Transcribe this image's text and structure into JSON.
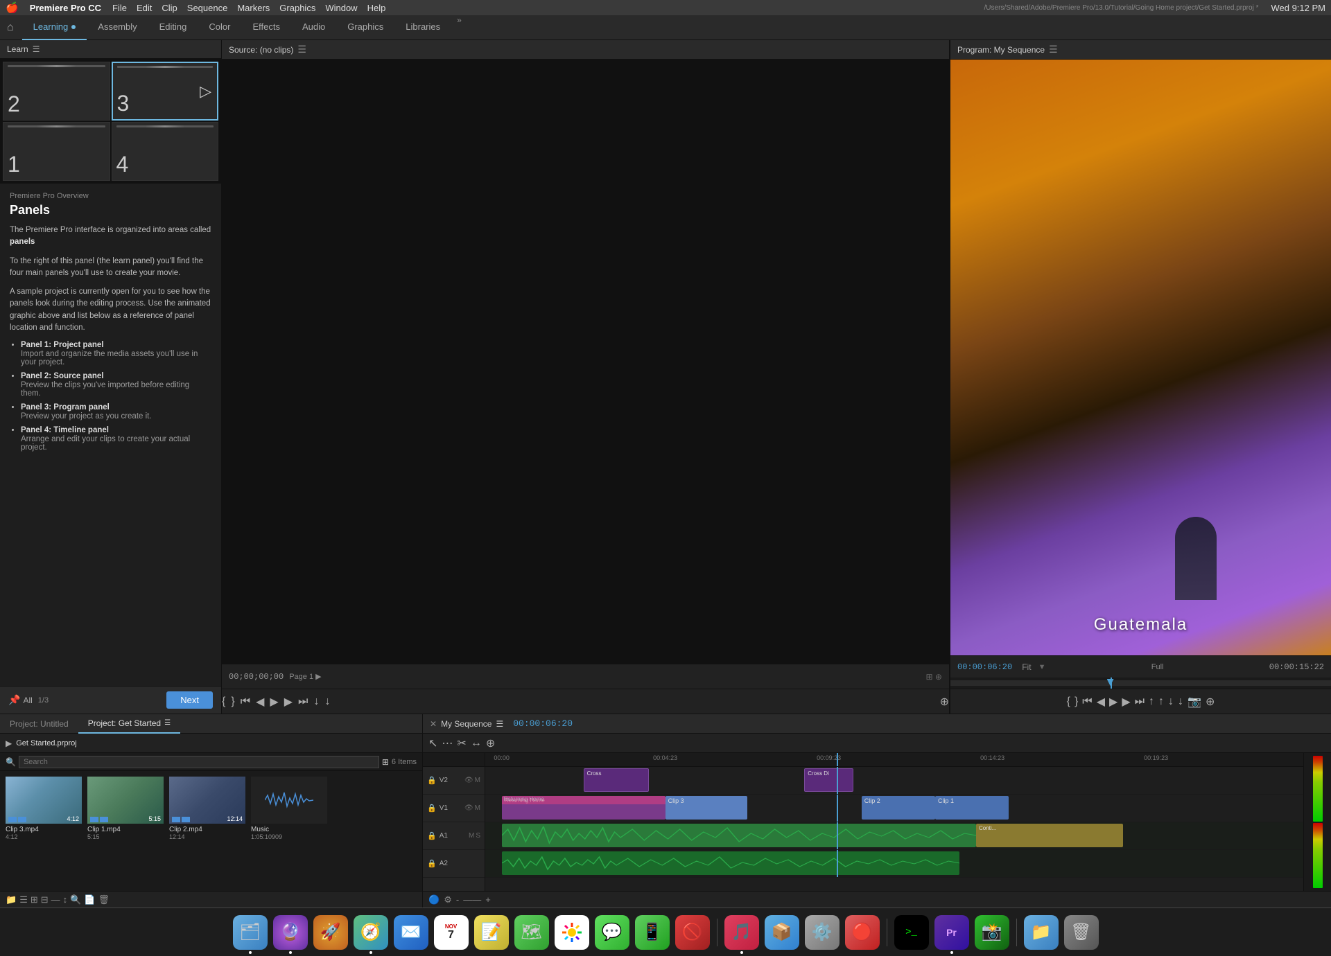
{
  "menubar": {
    "apple": "🍎",
    "app_name": "Premiere Pro CC",
    "menus": [
      "File",
      "Edit",
      "Clip",
      "Sequence",
      "Markers",
      "Graphics",
      "Window",
      "Help"
    ],
    "time": "Wed 9:12 PM",
    "path": "/Users/Shared/Adobe/Premiere Pro/13.0/Tutorial/Going Home project/Get Started.prproj *"
  },
  "workspace_tabs": [
    {
      "label": "Learning",
      "active": true,
      "dot": true
    },
    {
      "label": "Assembly",
      "active": false
    },
    {
      "label": "Editing",
      "active": false
    },
    {
      "label": "Color",
      "active": false
    },
    {
      "label": "Effects",
      "active": false
    },
    {
      "label": "Audio",
      "active": false
    },
    {
      "label": "Graphics",
      "active": false
    },
    {
      "label": "Libraries",
      "active": false
    }
  ],
  "learn_panel": {
    "header": "Learn",
    "thumbnails": [
      {
        "num": "2",
        "active": false
      },
      {
        "num": "3",
        "active": true,
        "play": true
      },
      {
        "num": "1",
        "active": false
      },
      {
        "num": "4",
        "active": false
      }
    ],
    "section_title": "Premiere Pro Overview",
    "title": "Panels",
    "body1": "The Premiere Pro interface is organized into areas called panels",
    "body2": "To the right of this panel (the learn panel) you'll find the four main panels you'll use to create your movie.",
    "body3": "A sample project is currently open for you to see how the panels look during the editing process. Use the animated graphic above and list below as a reference of panel location and function.",
    "panels": [
      {
        "name": "Panel 1: Project panel",
        "desc": "Import and organize the media assets you'll use in your project."
      },
      {
        "name": "Panel 2: Source panel",
        "desc": "Preview the clips you've imported before editing them."
      },
      {
        "name": "Panel 3: Program panel",
        "desc": "Preview your project as you create it."
      },
      {
        "name": "Panel 4: Timeline panel",
        "desc": "Arrange and edit your clips to create your actual project."
      }
    ],
    "footer": {
      "all_label": "All",
      "page": "1/3",
      "next_label": "Next"
    }
  },
  "source_panel": {
    "title": "Source: (no clips)"
  },
  "program_panel": {
    "title": "Program: My Sequence",
    "timecode": "00:00:06:20",
    "timecode_right": "00:00:15:22",
    "fit_label": "Fit",
    "quality_label": "Full",
    "overlay_text": "Guatemala"
  },
  "project_panel": {
    "tab_untitled": "Project: Untitled",
    "tab_started": "Project: Get Started",
    "folder_name": "Get Started.prproj",
    "item_count": "6 Items",
    "media": [
      {
        "name": "Clip 3.mp4",
        "duration": "4:12",
        "type": "clip3"
      },
      {
        "name": "Clip 1.mp4",
        "duration": "5:15",
        "type": "clip1"
      },
      {
        "name": "Clip 2.mp4",
        "duration": "12:14",
        "type": "clip2"
      },
      {
        "name": "Music",
        "duration": "1:05:10909",
        "type": "music"
      }
    ]
  },
  "timeline_panel": {
    "title": "My Sequence",
    "timecode": "00:00:06:20",
    "tracks": [
      {
        "name": "V2",
        "clips": []
      },
      {
        "name": "V1",
        "clips": [
          "Returning Home",
          "Clip 3",
          "Clip 2",
          "Clip 1"
        ]
      },
      {
        "name": "A1",
        "clips": [
          "audio_wave"
        ]
      },
      {
        "name": "A2",
        "clips": []
      }
    ],
    "ruler_marks": [
      "00:00",
      "00:04:23",
      "00:09:23",
      "00:14:23",
      "00:19:23"
    ]
  },
  "dock": {
    "items": [
      "🗂️",
      "🔮",
      "🚀",
      "🧭",
      "✉️",
      "📅",
      "📝",
      "🗺️",
      "🎨",
      "💬",
      "📱",
      "🚫",
      "🎵",
      "📦",
      "⚙️",
      "🔴",
      "🖥️",
      "🎬",
      "🟩",
      "📁",
      "🗑️"
    ]
  },
  "icons": {
    "play": "▶",
    "pause": "⏸",
    "rewind": "⏮",
    "fast_forward": "⏭",
    "step_back": "◀◀",
    "step_forward": "▶▶",
    "lock": "🔒",
    "more": "»"
  }
}
